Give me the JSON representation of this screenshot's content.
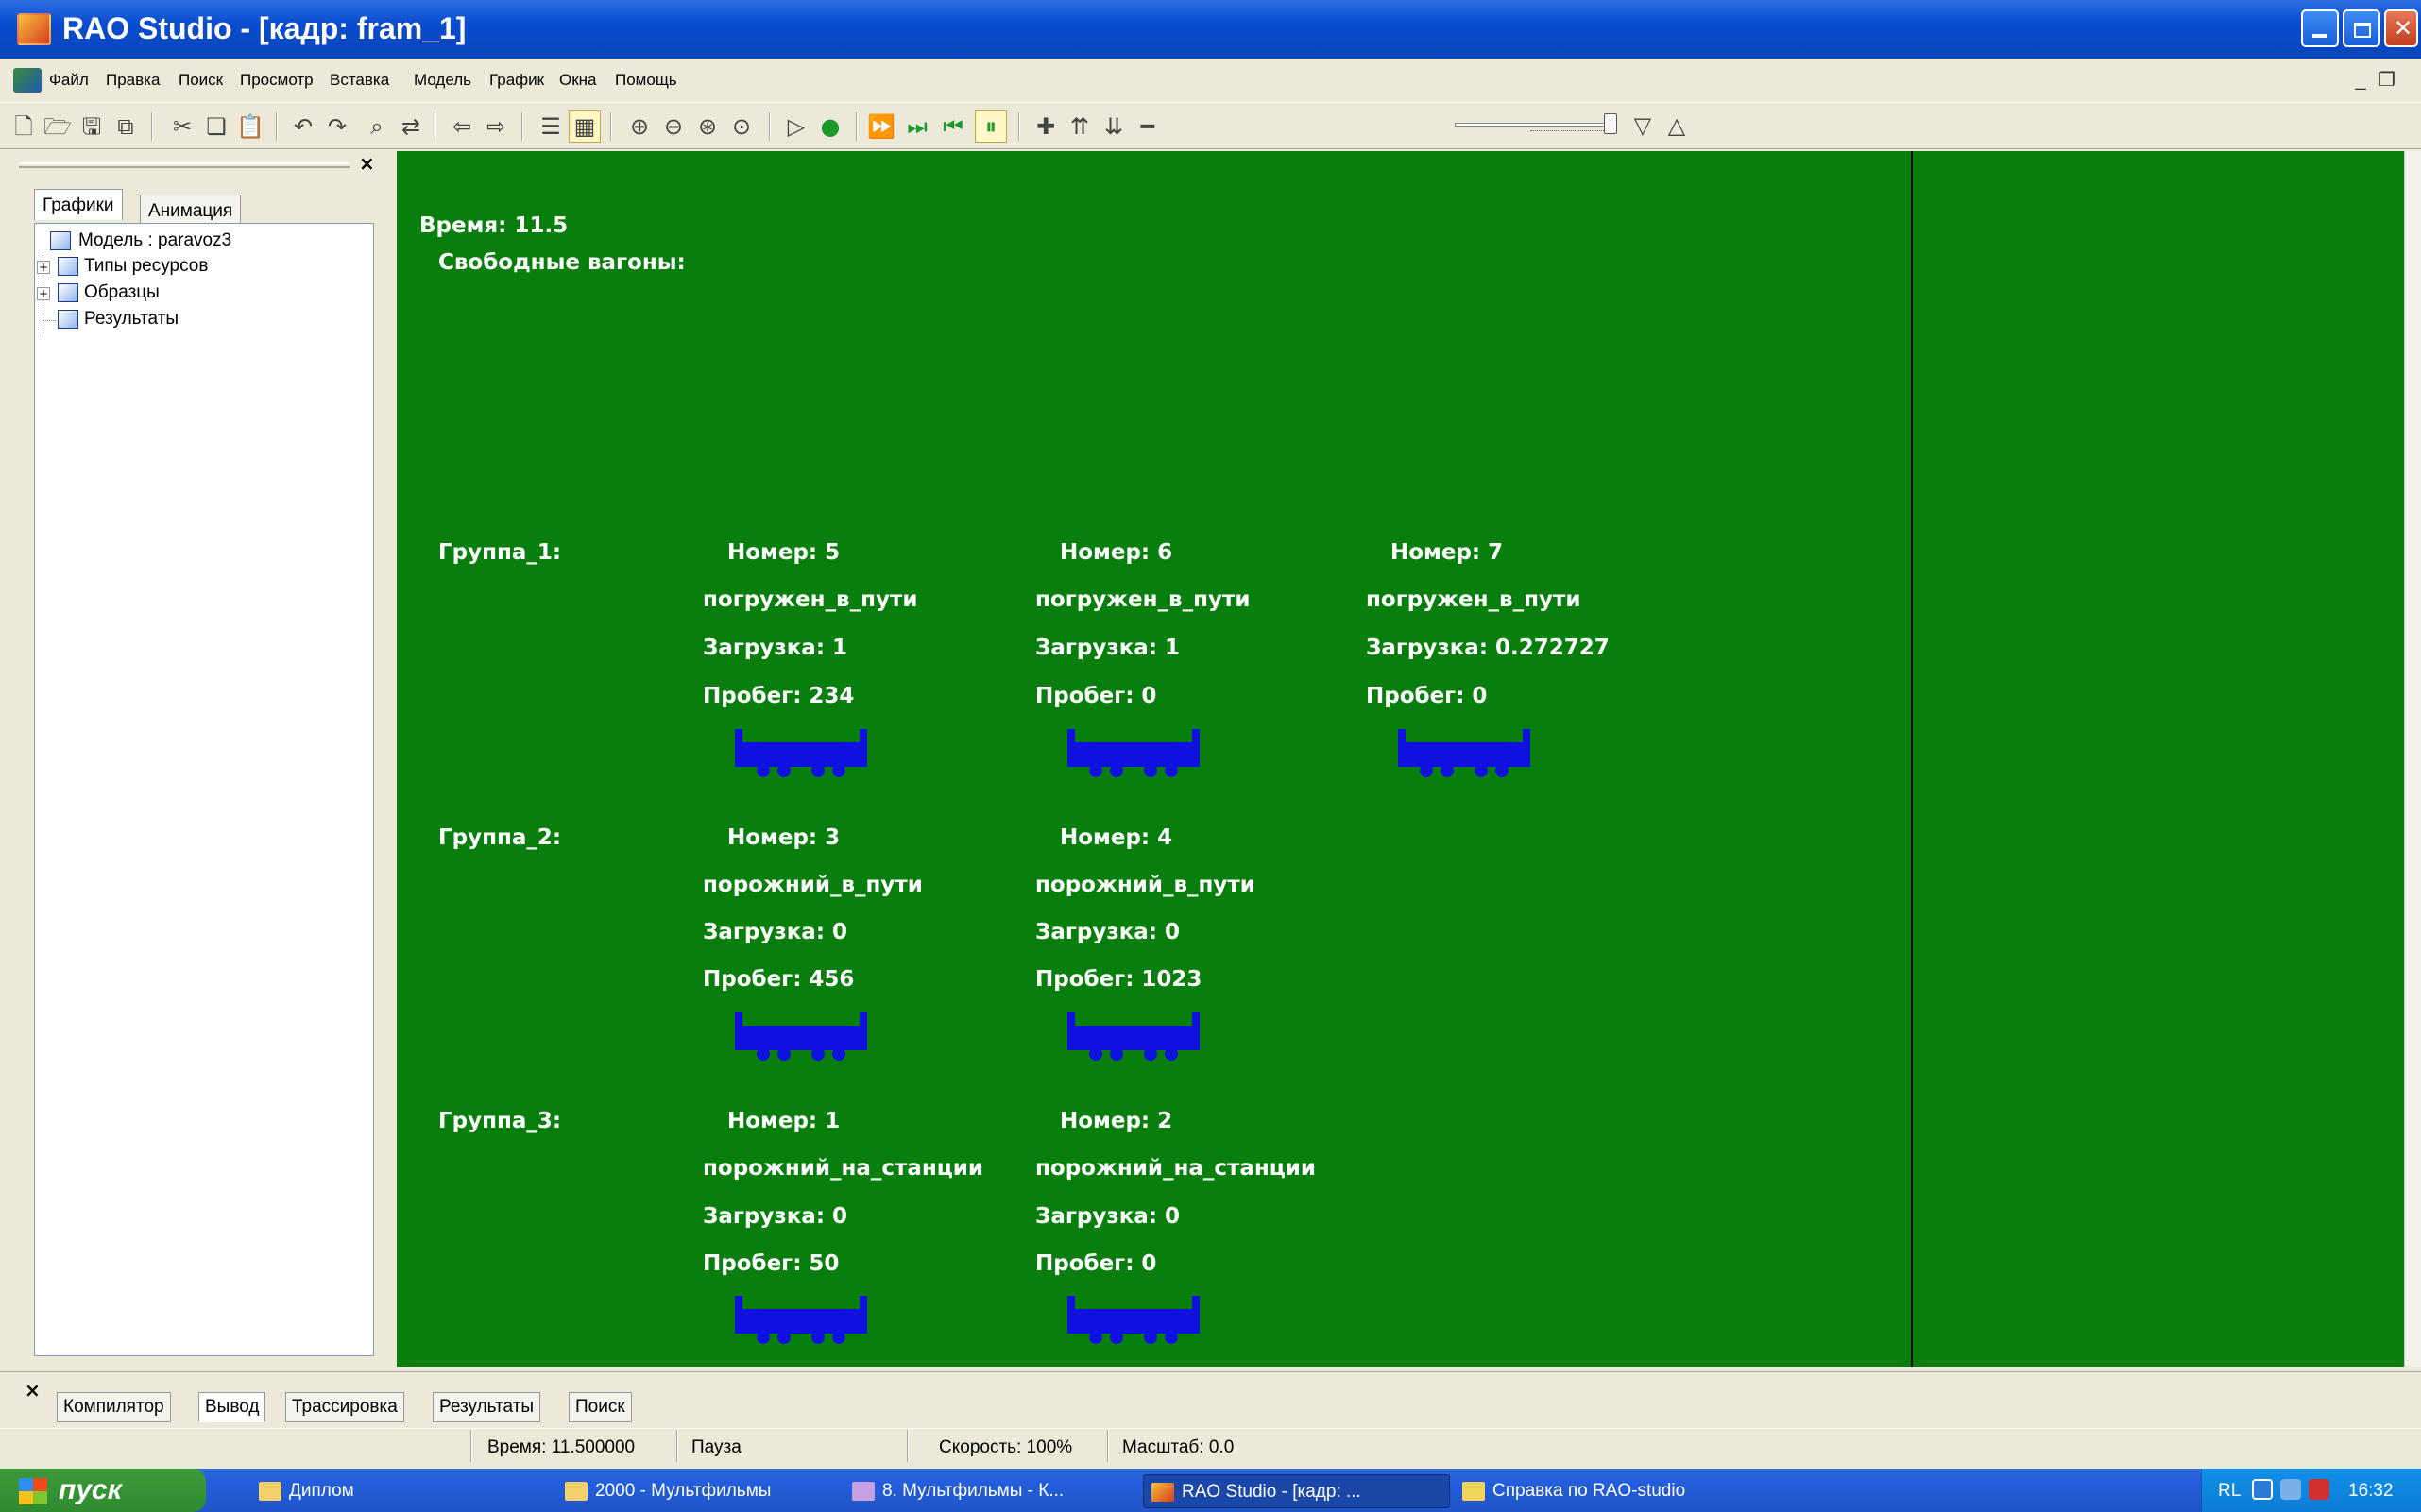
{
  "window": {
    "title": "RAO Studio - [кадр: fram_1]"
  },
  "menubar": {
    "items": [
      "Файл",
      "Правка",
      "Поиск",
      "Просмотр",
      "Вставка",
      "Модель",
      "График",
      "Окна",
      "Помощь"
    ]
  },
  "left_panel": {
    "tabs": [
      "Графики",
      "Анимация"
    ],
    "active_tab": "Графики",
    "tree": {
      "root": "Модель : paravoz3",
      "children": [
        "Типы ресурсов",
        "Образцы",
        "Результаты"
      ]
    }
  },
  "canvas": {
    "time_label": "Время: 11.5",
    "free_wagons_label": "Свободные вагоны:",
    "wagon_color": "#1010e0",
    "background_color": "#087f0d",
    "groups": [
      {
        "label": "Группа_1:",
        "wagons": [
          {
            "number": "Номер:  5",
            "state": "погружен_в_пути",
            "load": "Загрузка: 1",
            "run": "Пробег:    234"
          },
          {
            "number": "Номер:  6",
            "state": "погружен_в_пути",
            "load": "Загрузка: 1",
            "run": "Пробег:    0"
          },
          {
            "number": "Номер:  7",
            "state": "погружен_в_пути",
            "load": "Загрузка: 0.272727",
            "run": "Пробег:    0"
          }
        ]
      },
      {
        "label": "Группа_2:",
        "wagons": [
          {
            "number": "Номер:  3",
            "state": "порожний_в_пути",
            "load": "Загрузка: 0",
            "run": "Пробег:    456"
          },
          {
            "number": "Номер:  4",
            "state": "порожний_в_пути",
            "load": "Загрузка: 0",
            "run": "Пробег:    1023"
          }
        ]
      },
      {
        "label": "Группа_3:",
        "wagons": [
          {
            "number": "Номер:  1",
            "state": "порожний_на_станции",
            "load": "Загрузка: 0",
            "run": "Пробег:    50"
          },
          {
            "number": "Номер:  2",
            "state": "порожний_на_станции",
            "load": "Загрузка: 0",
            "run": "Пробег:    0"
          }
        ]
      }
    ]
  },
  "bottom_tabs": {
    "items": [
      "Компилятор",
      "Вывод",
      "Трассировка",
      "Результаты",
      "Поиск"
    ],
    "active": "Вывод"
  },
  "statusbar": {
    "time": "Время: 11.500000",
    "mode": "Пауза",
    "speed": "Скорость: 100%",
    "scale": "Масштаб: 0.0"
  },
  "taskbar": {
    "start_label": "пуск",
    "buttons": [
      "Диплом",
      "2000 - Мультфильмы",
      "8. Мультфильмы - К...",
      "RAO Studio - [кадр: ...",
      "Справка по RAO-studio"
    ],
    "active_index": 3,
    "tray": {
      "lang": "RL",
      "clock": "16:32"
    }
  },
  "toolbar_icons": [
    "new-icon",
    "open-icon",
    "save-icon",
    "save-all-icon",
    "cut-icon",
    "copy-icon",
    "paste-icon",
    "undo-icon",
    "redo-icon",
    "find-icon",
    "replace-icon",
    "back-icon",
    "forward-icon",
    "view-icon",
    "mode-icon",
    "zoom-in-icon",
    "zoom-out-icon",
    "zoom-fit-icon",
    "zoom-reset-icon",
    "run-icon",
    "record-icon",
    "step-fast-icon",
    "step-icon",
    "step-back-icon",
    "pause-icon",
    "plus-icon",
    "speed-up-icon",
    "speed-down-icon",
    "minus-icon",
    "triangle-down-icon",
    "triangle-up-icon"
  ]
}
